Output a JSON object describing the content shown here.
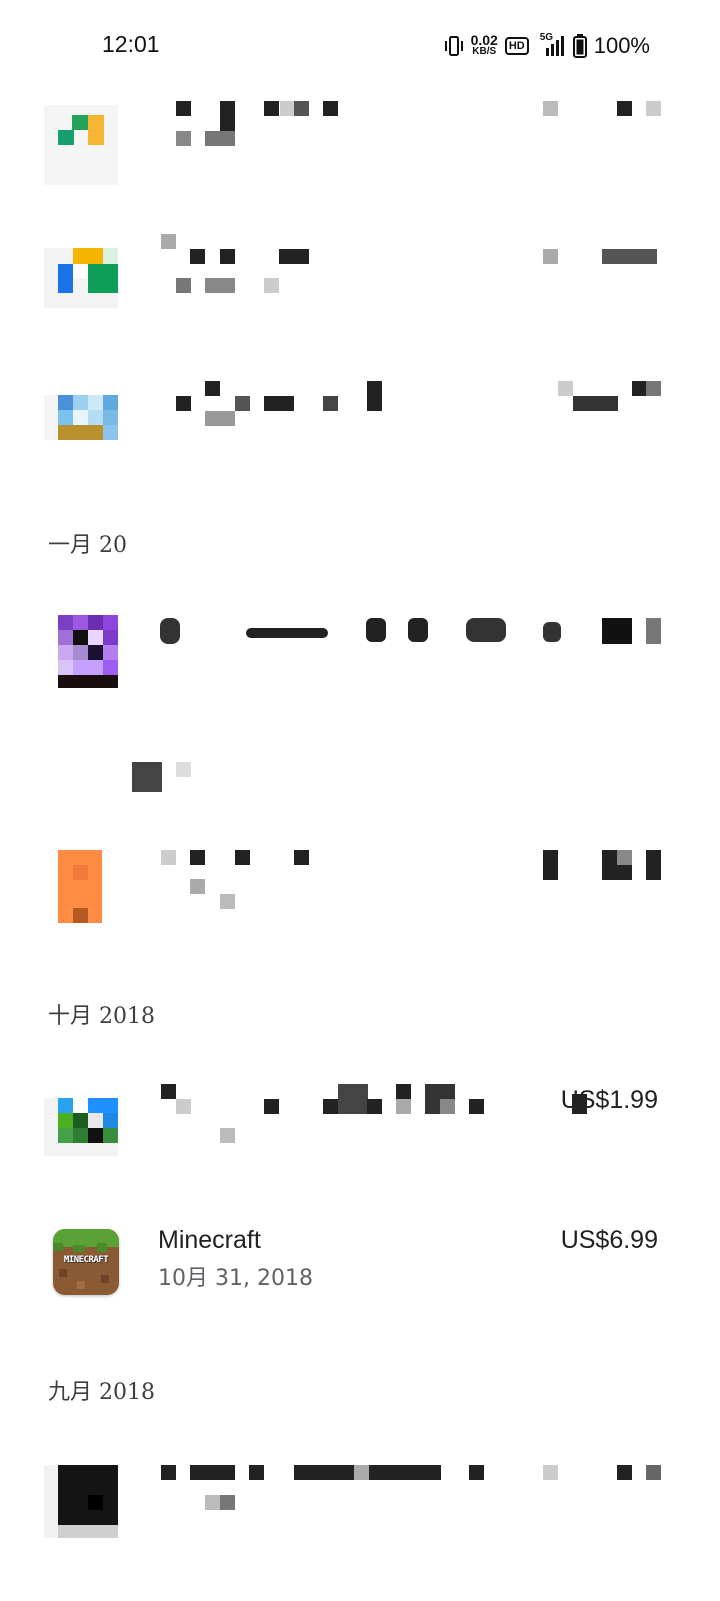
{
  "status_bar": {
    "time": "12:01",
    "net_speed_value": "0.02",
    "net_speed_unit": "KB/S",
    "hd_label": "HD",
    "network_label": "5G",
    "battery": "100%"
  },
  "sections": [
    {
      "label": "一月 20"
    },
    {
      "label": ""
    },
    {
      "label": "十月 2018"
    },
    {
      "label": "九月 2018"
    }
  ],
  "purchases": [
    {
      "name": "",
      "date": "",
      "price": ""
    },
    {
      "name": "",
      "date": "",
      "price": ""
    },
    {
      "name": "",
      "date": "",
      "price": ""
    },
    {
      "name": "",
      "date": "",
      "price": ""
    },
    {
      "name": "",
      "date": "",
      "price": ""
    },
    {
      "name": "",
      "date": "",
      "price": "US$1.99"
    },
    {
      "name": "Minecraft",
      "date": "10月 31, 2018",
      "price": "US$6.99",
      "icon_text": "MINECRAFT"
    },
    {
      "name": "",
      "date": "",
      "price": ""
    }
  ],
  "icons": [
    "vibrate-icon",
    "signal-icon",
    "battery-icon",
    "minecraft-app-icon"
  ]
}
